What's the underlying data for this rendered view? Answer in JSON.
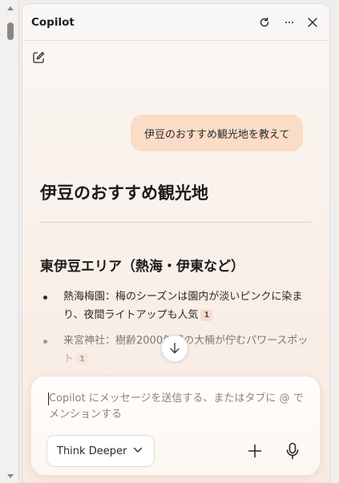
{
  "window": {
    "title": "Copilot"
  },
  "icons": {
    "refresh": "refresh-icon",
    "more": "more-icon",
    "close": "close-icon",
    "new_chat": "compose-icon",
    "scroll_down": "arrow-down-icon",
    "chevron": "chevron-down-icon",
    "plus": "plus-icon",
    "mic": "microphone-icon"
  },
  "conversation": {
    "user_message": "伊豆のおすすめ観光地を教えて",
    "answer_title": "伊豆のおすすめ観光地",
    "section_title": "東伊豆エリア（熱海・伊東など）",
    "bullets": [
      {
        "text": "熱海梅園：梅のシーズンは園内が淡いピンクに染まり、夜間ライトアップも人気",
        "citation": "1"
      },
      {
        "text": "来宮神社：樹齢2000年超の大楠が佇むパワースポット",
        "citation": "1"
      }
    ]
  },
  "composer": {
    "placeholder": "Copilot にメッセージを送信する、またはタブに @ でメンションする",
    "mode_label": "Think Deeper"
  },
  "colors": {
    "user_bubble": "#fbdcc6",
    "divider": "#efc8b4",
    "panel_bg": "#f9efe8"
  }
}
